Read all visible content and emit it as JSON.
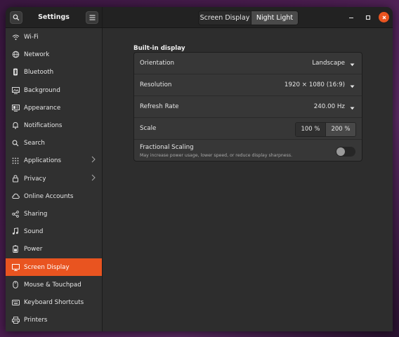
{
  "window": {
    "title": "Settings",
    "accent_color": "#e95420"
  },
  "header": {
    "search_icon": "search-icon",
    "menu_icon": "hamburger-menu-icon",
    "tabs": [
      {
        "label": "Screen Display",
        "active": false
      },
      {
        "label": "Night Light",
        "active": true
      }
    ],
    "controls": [
      "minimize-icon",
      "maximize-icon",
      "close-icon"
    ]
  },
  "sidebar": {
    "items": [
      {
        "label": "Wi-Fi",
        "icon": "wifi-icon"
      },
      {
        "label": "Network",
        "icon": "network-icon"
      },
      {
        "label": "Bluetooth",
        "icon": "bluetooth-icon"
      },
      {
        "label": "Background",
        "icon": "background-icon"
      },
      {
        "label": "Appearance",
        "icon": "appearance-icon"
      },
      {
        "label": "Notifications",
        "icon": "bell-icon"
      },
      {
        "label": "Search",
        "icon": "search-icon"
      },
      {
        "label": "Applications",
        "icon": "apps-grid-icon",
        "has_submenu": true
      },
      {
        "label": "Privacy",
        "icon": "privacy-icon",
        "has_submenu": true
      },
      {
        "label": "Online Accounts",
        "icon": "cloud-icon"
      },
      {
        "label": "Sharing",
        "icon": "share-icon"
      },
      {
        "label": "Sound",
        "icon": "music-note-icon"
      },
      {
        "label": "Power",
        "icon": "power-icon"
      },
      {
        "label": "Screen Display",
        "icon": "display-icon",
        "active": true
      },
      {
        "label": "Mouse & Touchpad",
        "icon": "mouse-icon"
      },
      {
        "label": "Keyboard Shortcuts",
        "icon": "keyboard-icon"
      },
      {
        "label": "Printers",
        "icon": "printer-icon"
      }
    ]
  },
  "main": {
    "section_title": "Built-in display",
    "orientation": {
      "label": "Orientation",
      "value": "Landscape"
    },
    "resolution": {
      "label": "Resolution",
      "value": "1920 × 1080 (16:9)"
    },
    "refresh_rate": {
      "label": "Refresh Rate",
      "value": "240.00 Hz"
    },
    "scale": {
      "label": "Scale",
      "options": [
        "100 %",
        "200 %"
      ],
      "selected": "200 %"
    },
    "fractional_scaling": {
      "label": "Fractional Scaling",
      "description": "May increase power usage, lower speed, or reduce display sharpness.",
      "enabled": false
    }
  }
}
